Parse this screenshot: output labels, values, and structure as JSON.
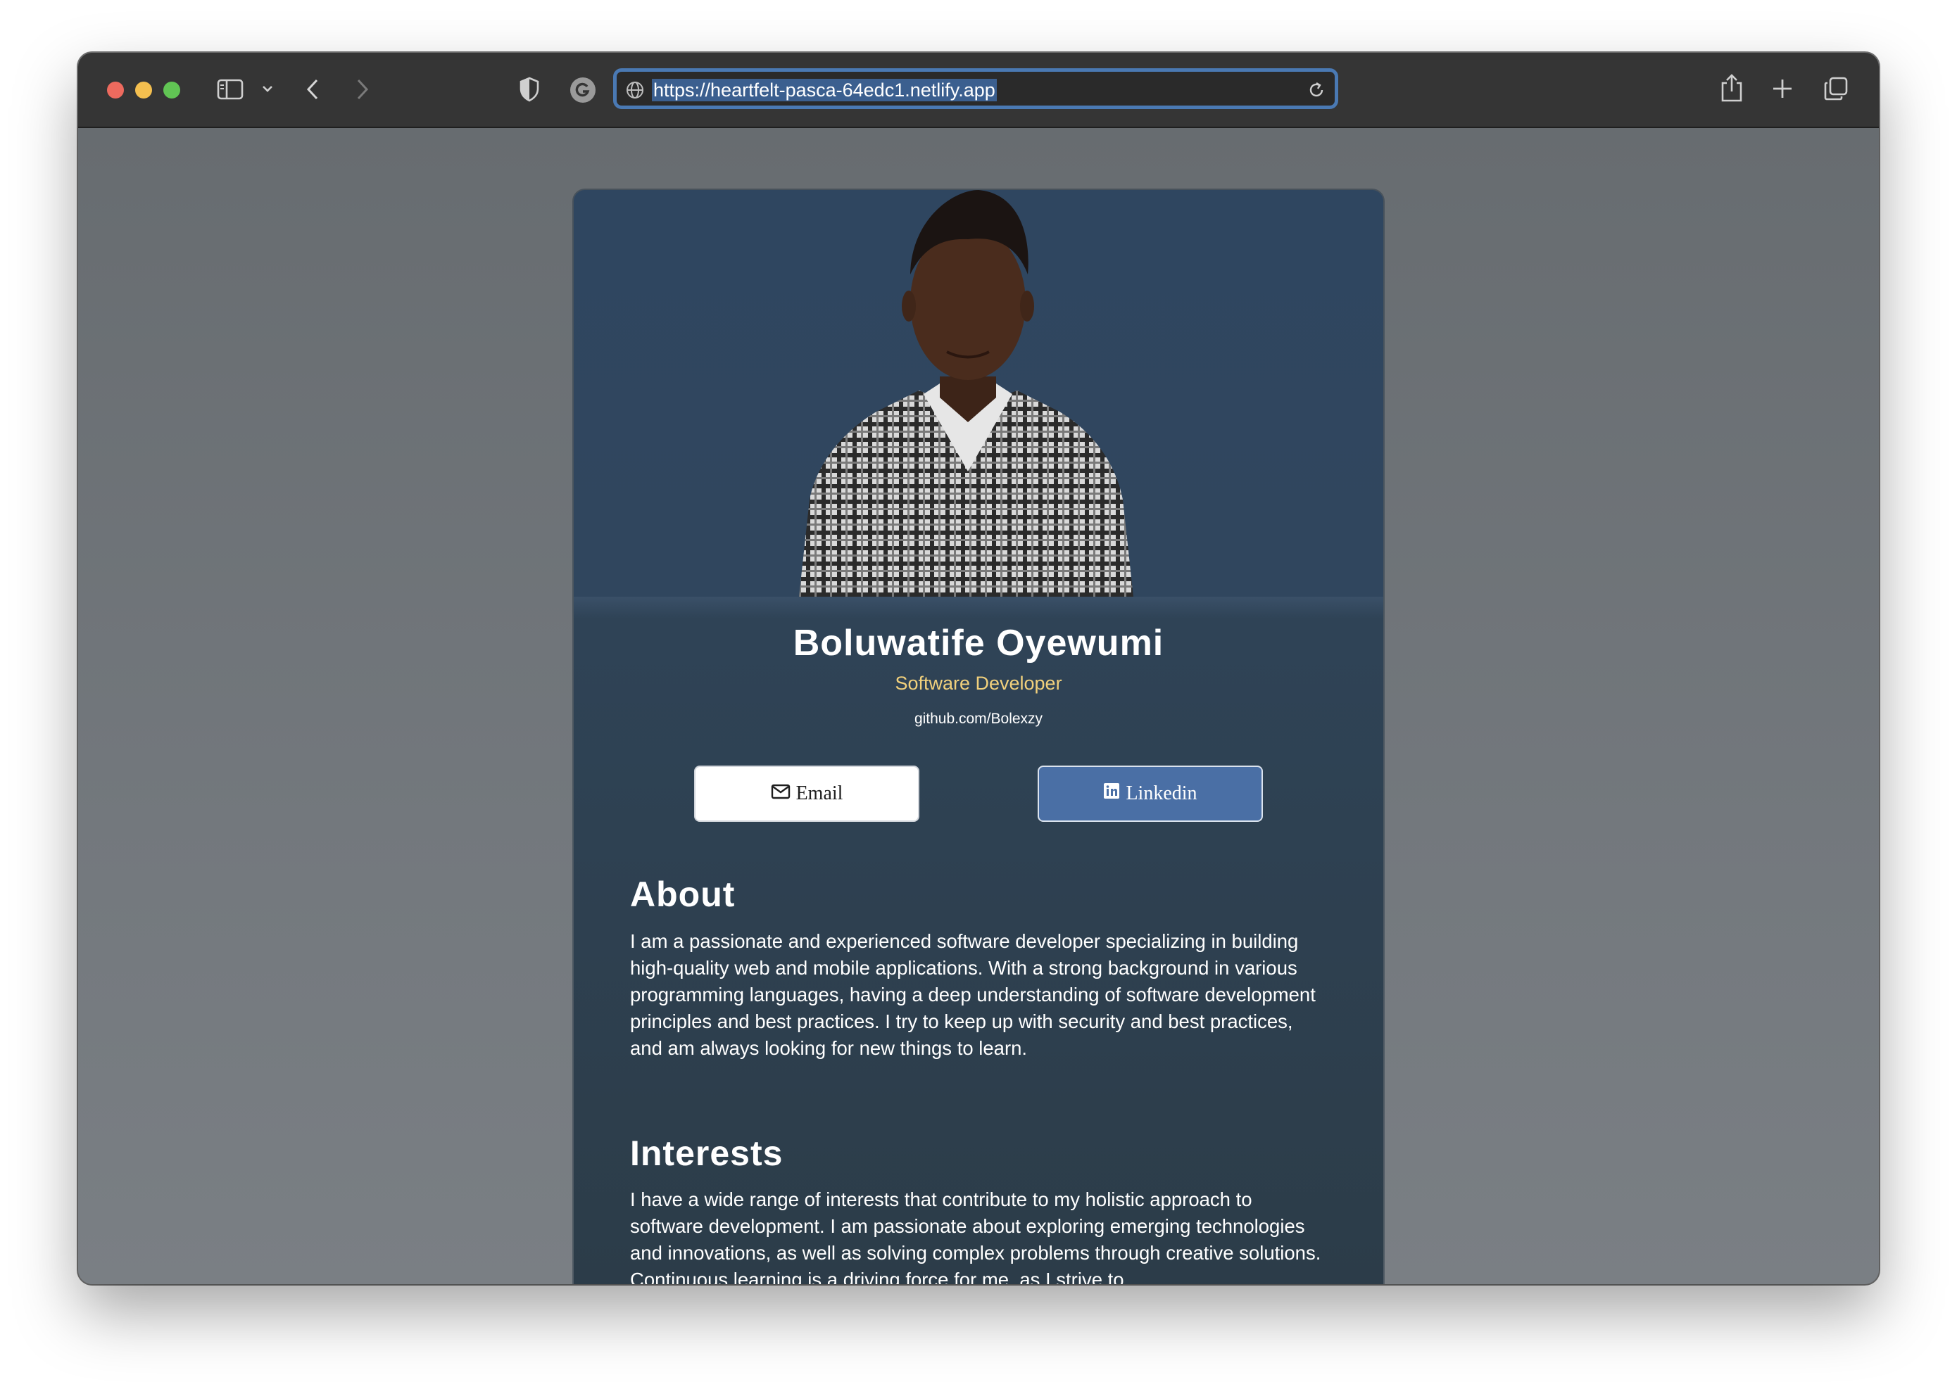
{
  "browser": {
    "url": "https://heartfelt-pasca-64edc1.netlify.app",
    "icons": [
      "sidebar-icon",
      "chevron-down-icon",
      "back-icon",
      "forward-icon",
      "shield-icon",
      "grammarly-icon",
      "globe-icon",
      "reload-icon",
      "share-icon",
      "plus-icon",
      "tabs-icon"
    ]
  },
  "profile": {
    "name": "Boluwatife Oyewumi",
    "role": "Software Developer",
    "website": "github.com/Bolexzy",
    "email_label": "Email",
    "linkedin_label": "Linkedin"
  },
  "about": {
    "title": "About",
    "body": "I am a passionate and experienced software developer specializing in building high-quality web and mobile applications. With a strong background in various programming languages, having a deep understanding of software development principles and best practices. I try to keep up with security and best practices, and am always looking for new things to learn."
  },
  "interests": {
    "title": "Interests",
    "body": "I have a wide range of interests that contribute to my holistic approach to software development. I am passionate about exploring emerging technologies and innovations, as well as solving complex problems through creative solutions. Continuous learning is a driving force for me, as I strive to"
  },
  "colors": {
    "accent": "#4a79b3",
    "role_text": "#f1d07c",
    "linkedin_button": "#4a6fa5",
    "card_background": "#2f4356"
  }
}
